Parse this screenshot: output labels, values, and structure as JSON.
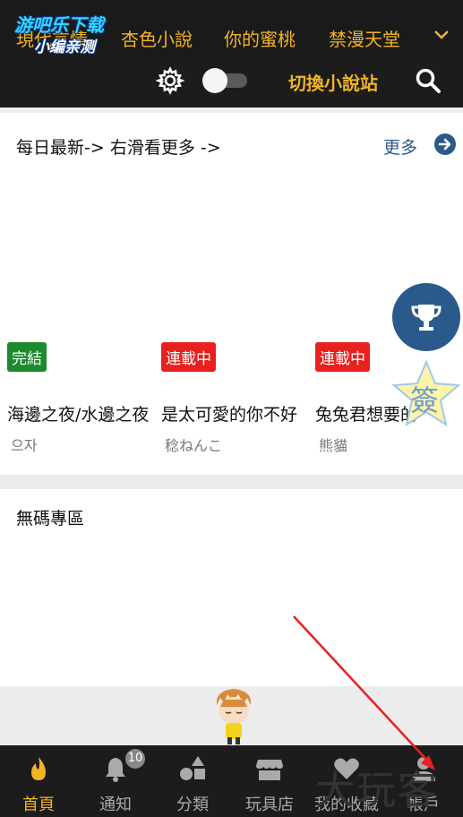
{
  "top_tabs": [
    "現代言情",
    "杏色小說",
    "你的蜜桃",
    "禁漫天堂"
  ],
  "watermark_top": {
    "line1": "游吧乐下载",
    "line2": "小编亲测"
  },
  "toolbar": {
    "switch_label": "切換小說站"
  },
  "section_latest": {
    "title": "每日最新-> 右滑看更多 ->",
    "more_label": "更多",
    "cards": [
      {
        "badge": "完結",
        "badge_color": "#1e8a2e",
        "title": "海邊之夜/水邊之夜",
        "author": "으자"
      },
      {
        "badge": "連載中",
        "badge_color": "#e8201e",
        "title": "是太可愛的你不好",
        "author": "稔ねんこ"
      },
      {
        "badge": "連載中",
        "badge_color": "#e8201e",
        "title": "兔兔君想要的",
        "author": "熊貓"
      }
    ]
  },
  "section_uncensored": {
    "title": "無碼專區"
  },
  "floating": {
    "trophy_icon": "trophy-icon",
    "sign_label": "簽"
  },
  "bottom_nav": [
    {
      "label": "首頁",
      "icon": "flame-icon",
      "active": true
    },
    {
      "label": "通知",
      "icon": "bell-icon",
      "active": false,
      "badge": "10"
    },
    {
      "label": "分類",
      "icon": "shapes-icon",
      "active": false
    },
    {
      "label": "玩具店",
      "icon": "store-icon",
      "active": false
    },
    {
      "label": "我的收藏",
      "icon": "heart-icon",
      "active": false
    },
    {
      "label": "帳戶",
      "icon": "user-icon",
      "active": false
    }
  ],
  "watermark_bottom": "大玩客",
  "colors": {
    "accent": "#f0b429",
    "link": "#2a5a8c",
    "dark": "#1c1c1c"
  }
}
